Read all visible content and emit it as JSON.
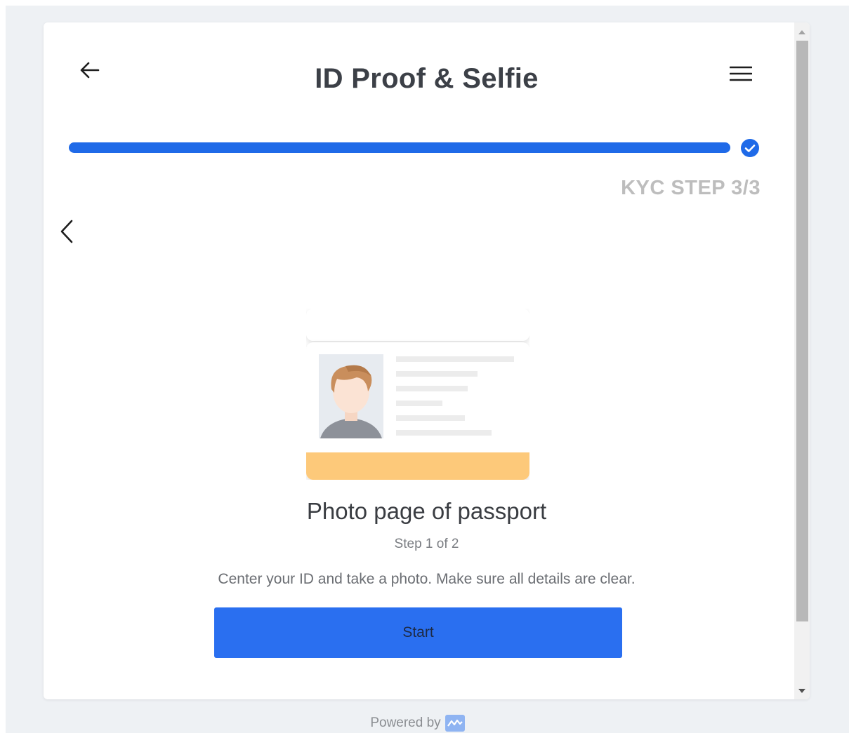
{
  "header": {
    "title": "ID Proof & Selfie",
    "back_icon": "arrow-left-icon",
    "menu_icon": "hamburger-menu-icon"
  },
  "progress": {
    "value": 1.0,
    "step_label": "KYC STEP 3/3",
    "complete_icon": "check-circle-icon"
  },
  "carousel": {
    "prev_icon": "chevron-left-icon"
  },
  "document": {
    "illustration_icon": "passport-photo-page-icon",
    "title": "Photo page of passport",
    "step": "Step 1 of 2",
    "instruction": "Center your ID and take a photo. Make sure all details are clear."
  },
  "actions": {
    "start_label": "Start"
  },
  "footer": {
    "powered_by": "Powered by",
    "logo_icon": "brand-logo-icon"
  },
  "colors": {
    "accent": "#1f6ae8",
    "button": "#2a6ff0",
    "card_strip": "#fdc97a",
    "muted": "#bdbdbd"
  }
}
